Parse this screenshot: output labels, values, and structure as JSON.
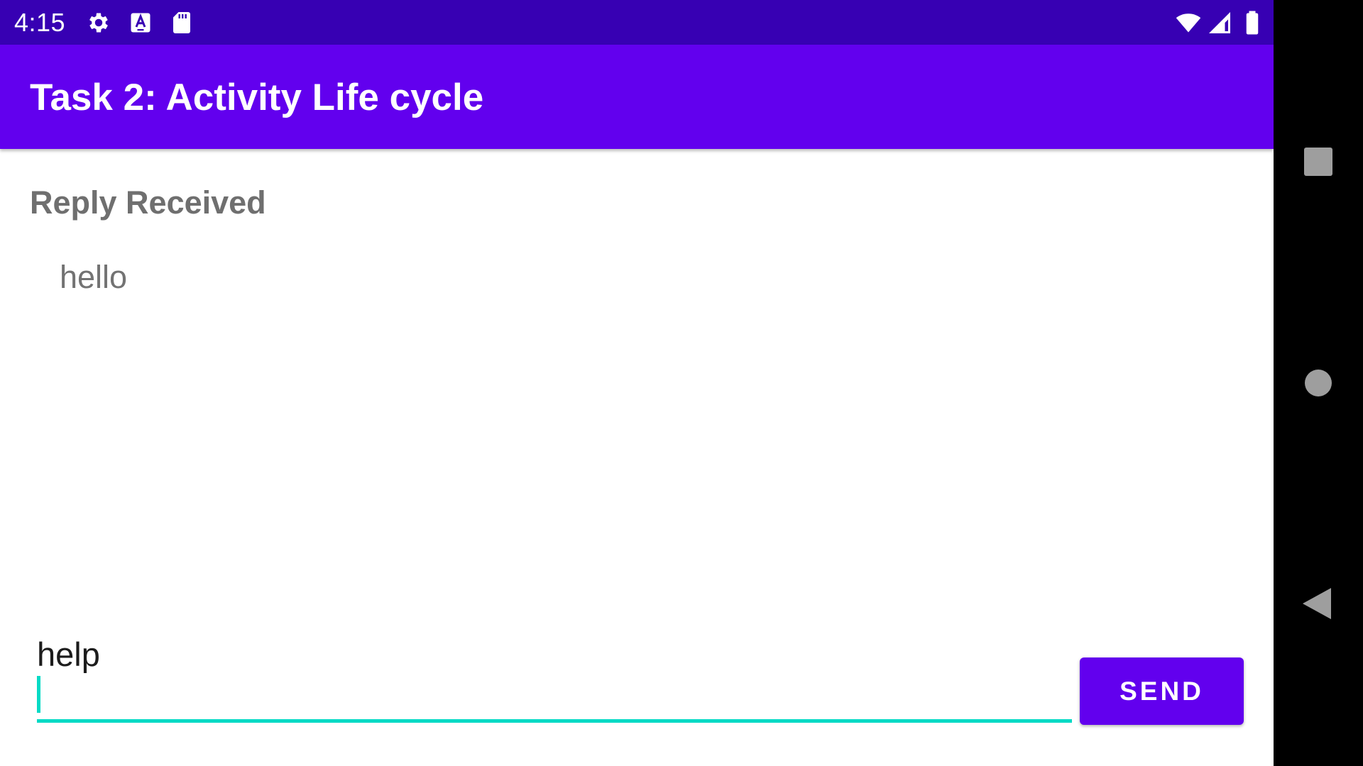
{
  "status_bar": {
    "time": "4:15",
    "left_icons": [
      "gear-icon",
      "accessibility-a-icon",
      "sd-card-icon"
    ],
    "right_icons": [
      "wifi-icon",
      "cellular-signal-icon",
      "battery-icon"
    ],
    "background": "#3700B3"
  },
  "app_bar": {
    "title": "Task 2: Activity Life cycle",
    "background": "#6200EE"
  },
  "content": {
    "reply_header": "Reply Received",
    "reply_message": "hello"
  },
  "input": {
    "value": "help",
    "accent": "#03DAC5"
  },
  "send_button": {
    "label": "SEND"
  },
  "nav_bar": {
    "buttons": [
      "recents-square-icon",
      "home-circle-icon",
      "back-triangle-icon"
    ]
  }
}
